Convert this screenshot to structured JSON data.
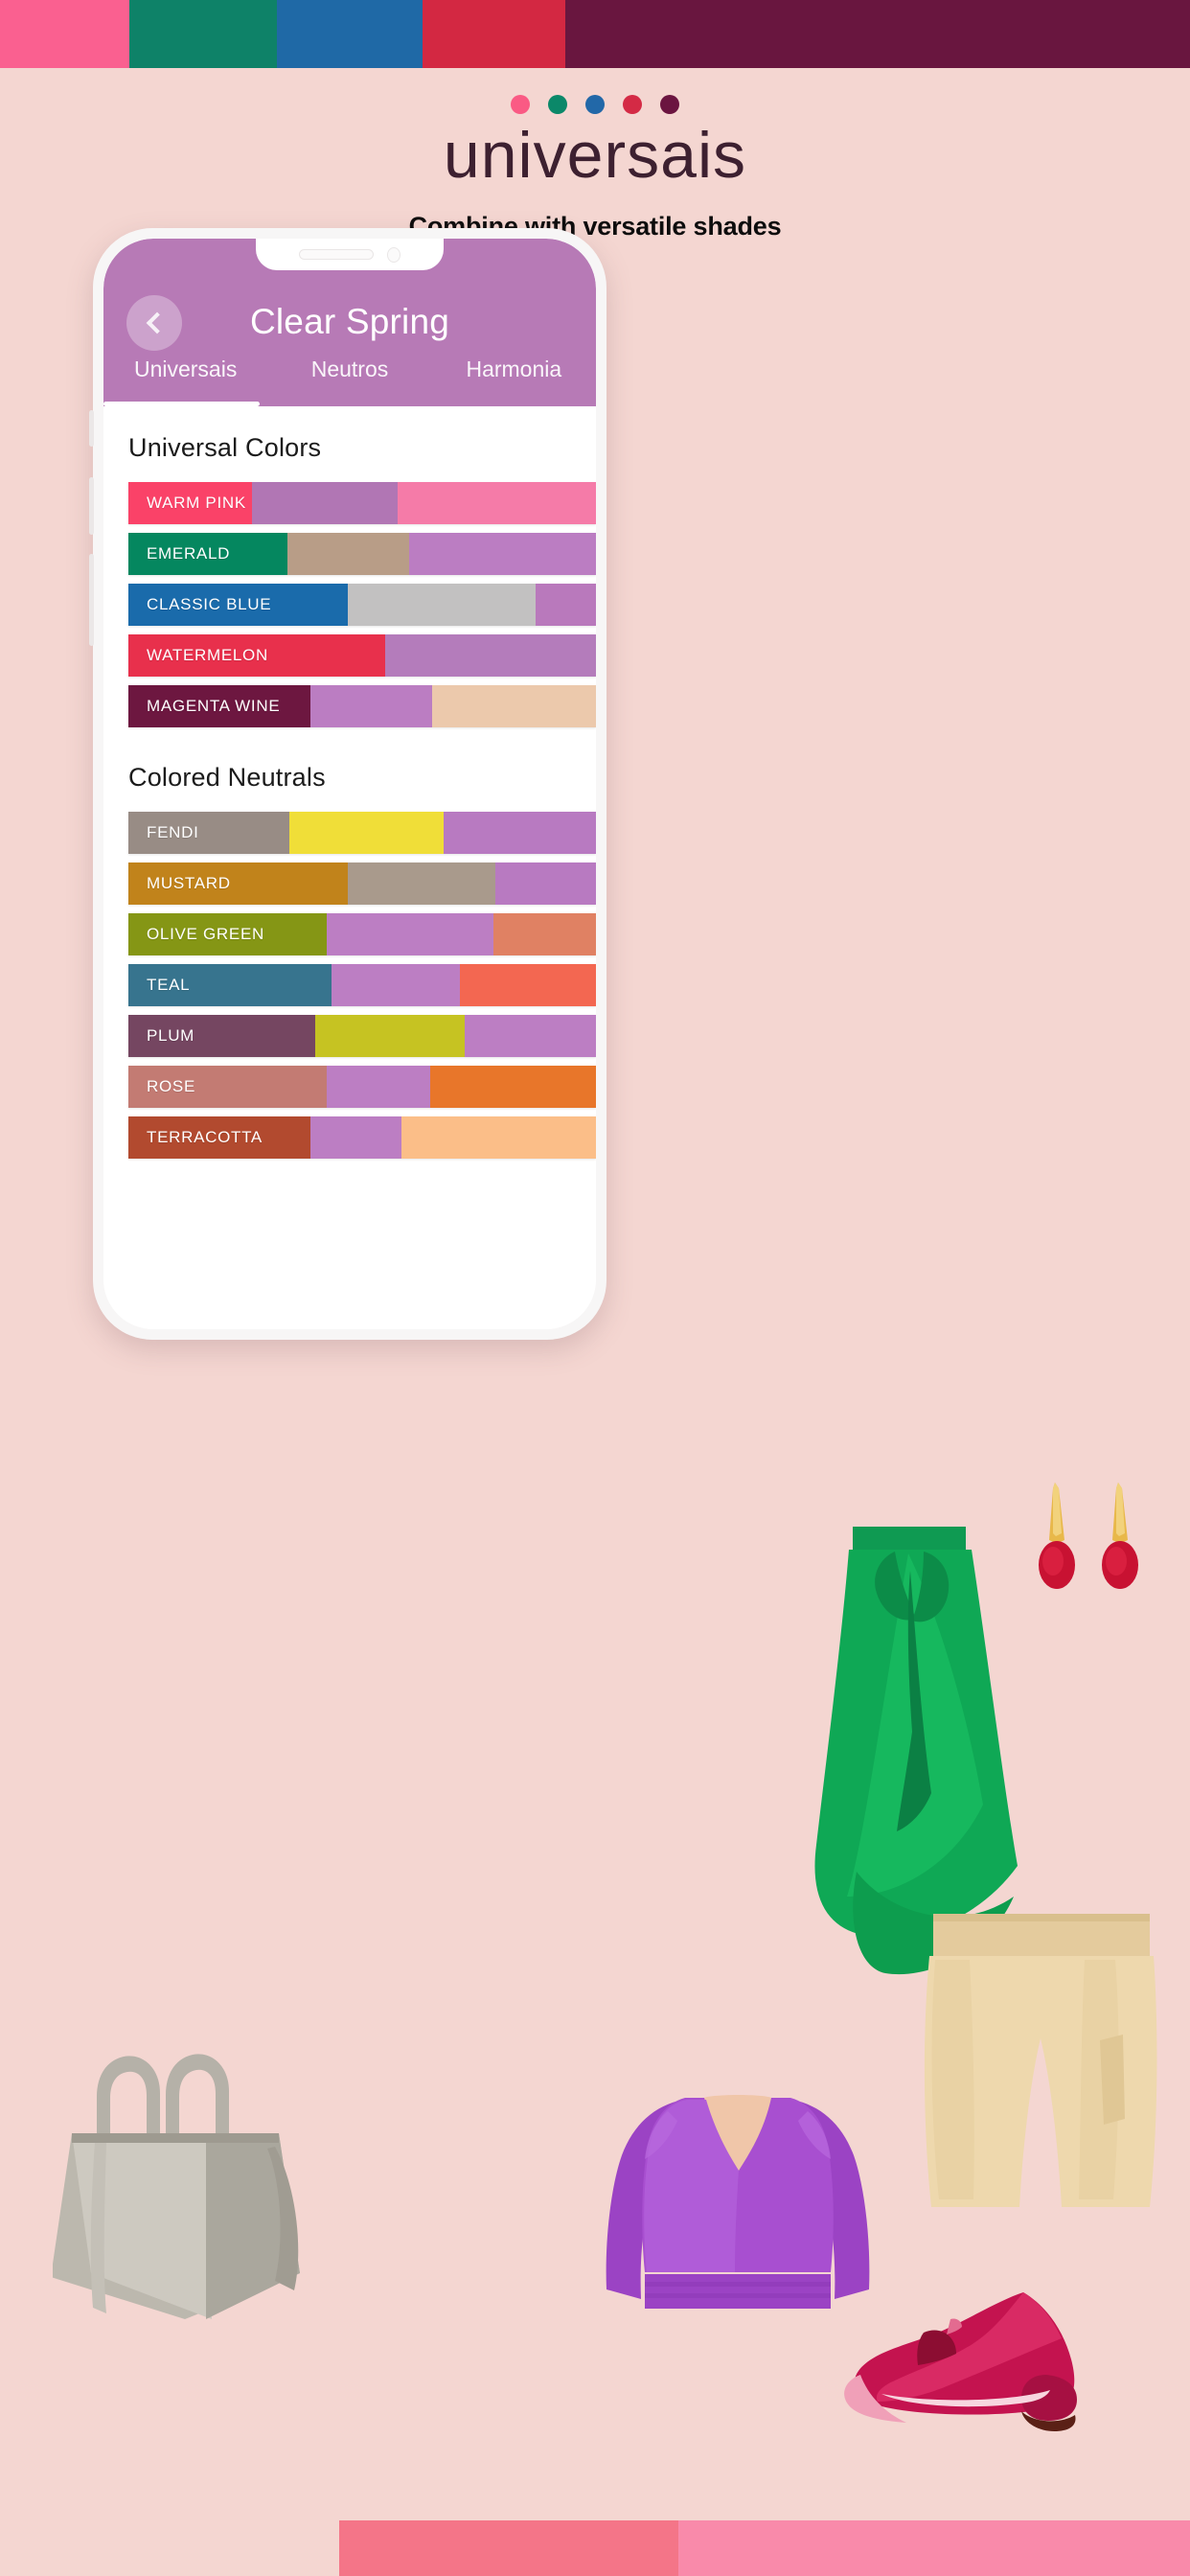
{
  "brand": {
    "name": "universais",
    "tagline": "Combine with versatile shades",
    "dot_colors": [
      "#fa5a84",
      "#0b8869",
      "#2268a8",
      "#d42a45",
      "#6b1440"
    ]
  },
  "top_strip": {
    "bands": [
      {
        "name": "warm-pink-band",
        "color": "#fa6090",
        "width_pct": 10.9
      },
      {
        "name": "emerald-band",
        "color": "#0e8268",
        "width_pct": 12.4
      },
      {
        "name": "classic-blue-band",
        "color": "#1f69a6",
        "width_pct": 12.2
      },
      {
        "name": "watermelon-band",
        "color": "#d32842",
        "width_pct": 12.0
      },
      {
        "name": "magenta-wine-band",
        "color": "#69163f",
        "width_pct": 52.5
      }
    ]
  },
  "bottom_strip": {
    "bands": [
      {
        "name": "pale-band",
        "color": "#f4d6d1",
        "width_pct": 28.5
      },
      {
        "name": "coral-pink-band",
        "color": "#f47588",
        "width_pct": 28.5
      },
      {
        "name": "light-pink-band",
        "color": "#f98aaa",
        "width_pct": 43.0
      }
    ]
  },
  "phone": {
    "header": {
      "back_icon": "chevron-left-icon",
      "title": "Clear Spring",
      "tabs": [
        {
          "label": "Universais",
          "active": true
        },
        {
          "label": "Neutros",
          "active": false
        },
        {
          "label": "Harmonia",
          "active": false
        }
      ]
    },
    "sections": [
      {
        "id": "universal-colors",
        "title": "Universal Colors",
        "rows": [
          {
            "label": "WARM PINK",
            "segments": [
              {
                "color": "#fa4268",
                "width_pct": 26.5
              },
              {
                "color": "#b176b4",
                "width_pct": 31.0
              },
              {
                "color": "#f57ba8",
                "width_pct": 42.5
              }
            ]
          },
          {
            "label": "EMERALD",
            "segments": [
              {
                "color": "#05875f",
                "width_pct": 34.0
              },
              {
                "color": "#b89d87",
                "width_pct": 26.0
              },
              {
                "color": "#bb7dc2",
                "width_pct": 40.0
              }
            ]
          },
          {
            "label": "CLASSIC BLUE",
            "segments": [
              {
                "color": "#1a6bab",
                "width_pct": 47.0
              },
              {
                "color": "#c2c1c1",
                "width_pct": 40.0
              },
              {
                "color": "#b979bc",
                "width_pct": 13.0
              }
            ]
          },
          {
            "label": "WATERMELON",
            "segments": [
              {
                "color": "#e8304c",
                "width_pct": 55.0
              },
              {
                "color": "#b47cbb",
                "width_pct": 45.0
              },
              {
                "color": "#b47cbb",
                "width_pct": 0
              }
            ]
          },
          {
            "label": "MAGENTA WINE",
            "segments": [
              {
                "color": "#6d1740",
                "width_pct": 39.0
              },
              {
                "color": "#bb7dc2",
                "width_pct": 26.0
              },
              {
                "color": "#ecc9ac",
                "width_pct": 35.0
              }
            ]
          }
        ]
      },
      {
        "id": "colored-neutrals",
        "title": "Colored Neutrals",
        "rows": [
          {
            "label": "FENDI",
            "segments": [
              {
                "color": "#988c85",
                "width_pct": 34.5
              },
              {
                "color": "#f0de38",
                "width_pct": 33.0
              },
              {
                "color": "#b87ac1",
                "width_pct": 32.5
              }
            ]
          },
          {
            "label": "MUSTARD",
            "segments": [
              {
                "color": "#c1831b",
                "width_pct": 47.0
              },
              {
                "color": "#a99a8c",
                "width_pct": 31.5
              },
              {
                "color": "#b87ac1",
                "width_pct": 21.5
              }
            ]
          },
          {
            "label": "OLIVE GREEN",
            "segments": [
              {
                "color": "#859615",
                "width_pct": 42.5
              },
              {
                "color": "#bc7ec3",
                "width_pct": 35.5
              },
              {
                "color": "#e08163",
                "width_pct": 22.0
              }
            ]
          },
          {
            "label": "TEAL",
            "segments": [
              {
                "color": "#37748e",
                "width_pct": 43.5
              },
              {
                "color": "#bc7ec3",
                "width_pct": 27.5
              },
              {
                "color": "#f36751",
                "width_pct": 29.0
              }
            ]
          },
          {
            "label": "PLUM",
            "segments": [
              {
                "color": "#754661",
                "width_pct": 40.0
              },
              {
                "color": "#c6c322",
                "width_pct": 32.0
              },
              {
                "color": "#bc7ec3",
                "width_pct": 28.0
              }
            ]
          },
          {
            "label": "ROSE",
            "segments": [
              {
                "color": "#c37b73",
                "width_pct": 42.5
              },
              {
                "color": "#bc7ec3",
                "width_pct": 22.0
              },
              {
                "color": "#e8762a",
                "width_pct": 35.5
              }
            ]
          },
          {
            "label": "TERRACOTTA",
            "segments": [
              {
                "color": "#b24a2f",
                "width_pct": 39.0
              },
              {
                "color": "#bc7ec3",
                "width_pct": 19.5
              },
              {
                "color": "#fbbe88",
                "width_pct": 41.5
              }
            ]
          }
        ]
      }
    ]
  },
  "fashion_items": [
    {
      "name": "earrings",
      "description": "red teardrop earrings"
    },
    {
      "name": "green-skirt",
      "description": "emerald green ruffled wrap skirt"
    },
    {
      "name": "beige-shorts",
      "description": "beige high-waist shorts"
    },
    {
      "name": "handbag",
      "description": "grey leather tote bag"
    },
    {
      "name": "purple-blouse",
      "description": "purple puff-sleeve crop top"
    },
    {
      "name": "pink-shoe",
      "description": "magenta block-heel pump"
    }
  ],
  "colors": {
    "page_bg": "#f4d6d1",
    "accent_purple": "#b77ab6",
    "brand_text": "#3d2030"
  }
}
